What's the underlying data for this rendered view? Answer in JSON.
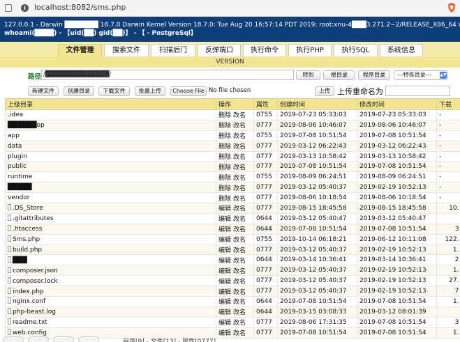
{
  "browser": {
    "url": "localhost:8082/sms.php"
  },
  "header": {
    "line1": "127.0.0.1 - Darwin ███████ 18.7.0 Darwin Kernel Version 18.7.0: Tue Aug 20 16:57:14 PDT 2019; root:xnu-4███3.271.2~2/RELEASE_X86_64 x86_64",
    "line2": "whoami(████) - 【uid(██) gid(██)】 - 【 - PostgreSql】"
  },
  "tabs": [
    "文件管理",
    "搜索文件",
    "扫描后门",
    "反弹端口",
    "执行命令",
    "执行PHP",
    "执行SQL",
    "系统信息"
  ],
  "version_label": "VERSION",
  "path": {
    "label": "路径",
    "value": "/██████████████/",
    "goto": "转到",
    "root_dir": "根目录",
    "app_dir": "程序目录",
    "special_select": "---特殊目录---"
  },
  "actions": {
    "new_file": "新建文件",
    "new_dir": "创建目录",
    "download": "下载文件",
    "batch_upload": "批量上传",
    "choose_file": "Choose File",
    "no_file": "No file chosen",
    "upload": "上传",
    "rename_label": "上传重命名为"
  },
  "table": {
    "headers": [
      "上级目录",
      "操作",
      "属性",
      "创建时间",
      "修改时间",
      "下载"
    ],
    "rows": [
      {
        "name": ".idea",
        "ops": [
          "删除",
          "改名"
        ],
        "perm": "0755",
        "created": "2019-07-23 05:33:03",
        "modified": "2019-07-23 05:33:03",
        "size": "-",
        "file": false
      },
      {
        "name": "██████op",
        "ops": [
          "删除",
          "改名"
        ],
        "perm": "0777",
        "created": "2019-08-06 10:46:07",
        "modified": "2019-08-06 10:46:07",
        "size": "-",
        "file": false
      },
      {
        "name": "app",
        "ops": [
          "删除",
          "改名"
        ],
        "perm": "0755",
        "created": "2019-07-08 10:51:54",
        "modified": "2019-07-08 10:51:54",
        "size": "-",
        "file": false
      },
      {
        "name": "data",
        "ops": [
          "删除",
          "改名"
        ],
        "perm": "0777",
        "created": "2019-03-12 06:22:43",
        "modified": "2019-03-12 06:22:43",
        "size": "-",
        "file": false
      },
      {
        "name": "plugin",
        "ops": [
          "删除",
          "改名"
        ],
        "perm": "0777",
        "created": "2019-03-13 10:58:42",
        "modified": "2019-03-13 10:58:42",
        "size": "-",
        "file": false
      },
      {
        "name": "public",
        "ops": [
          "删除",
          "改名"
        ],
        "perm": "0777",
        "created": "2019-07-08 10:51:54",
        "modified": "2019-07-08 10:51:54",
        "size": "-",
        "file": false
      },
      {
        "name": "runtime",
        "ops": [
          "删除",
          "改名"
        ],
        "perm": "0755",
        "created": "2019-08-09 06:24:51",
        "modified": "2019-08-09 06:24:51",
        "size": "-",
        "file": false
      },
      {
        "name": "█████",
        "ops": [
          "删除",
          "改名"
        ],
        "perm": "0777",
        "created": "2019-03-12 05:40:37",
        "modified": "2019-02-19 10:52:13",
        "size": "-",
        "file": false
      },
      {
        "name": "vendor",
        "ops": [
          "删除",
          "改名"
        ],
        "perm": "0777",
        "created": "2019-08-06 10:18:54",
        "modified": "2019-08-06 10:18:54",
        "size": "-",
        "file": false
      },
      {
        "name": ".DS_Store",
        "ops": [
          "编辑",
          "改名"
        ],
        "perm": "0777",
        "created": "2019-08-15 18:45:58",
        "modified": "2019-08-15 18:45:58",
        "size": "10.",
        "file": true
      },
      {
        "name": ".gitattributes",
        "ops": [
          "编辑",
          "改名"
        ],
        "perm": "0644",
        "created": "2019-03-12 05:40:47",
        "modified": "2019-03-12 05:40:47",
        "size": "",
        "file": true
      },
      {
        "name": ".htaccess",
        "ops": [
          "编辑",
          "改名"
        ],
        "perm": "0644",
        "created": "2019-07-08 10:51:54",
        "modified": "2019-07-08 10:51:54",
        "size": "3",
        "file": true
      },
      {
        "name": "Sms.php",
        "ops": [
          "编辑",
          "改名"
        ],
        "perm": "0755",
        "created": "2019-10-14 06:18:21",
        "modified": "2019-06-12 10:11:08",
        "size": "122.",
        "file": true
      },
      {
        "name": "build.php",
        "ops": [
          "编辑",
          "改名"
        ],
        "perm": "0777",
        "created": "2019-03-12 05:40:37",
        "modified": "2019-02-19 10:52:13",
        "size": "1.",
        "file": true
      },
      {
        "name": "███",
        "ops": [
          "编辑",
          "改名"
        ],
        "perm": "0644",
        "created": "2019-03-14 10:36:41",
        "modified": "2019-03-14 10:36:41",
        "size": "2",
        "file": true
      },
      {
        "name": "composer.json",
        "ops": [
          "编辑",
          "改名"
        ],
        "perm": "0777",
        "created": "2019-03-12 05:40:37",
        "modified": "2019-02-19 10:52:13",
        "size": "1.",
        "file": true
      },
      {
        "name": "composer.lock",
        "ops": [
          "编辑",
          "改名"
        ],
        "perm": "0777",
        "created": "2019-03-12 05:40:37",
        "modified": "2019-02-19 10:52:13",
        "size": "27.",
        "file": true
      },
      {
        "name": "index.php",
        "ops": [
          "编辑",
          "改名"
        ],
        "perm": "0777",
        "created": "2019-03-12 05:40:37",
        "modified": "2019-02-19 10:52:13",
        "size": "7",
        "file": true
      },
      {
        "name": "nginx.conf",
        "ops": [
          "编辑",
          "改名"
        ],
        "perm": "0644",
        "created": "2019-07-08 10:51:54",
        "modified": "2019-07-08 10:51:54",
        "size": "1.",
        "file": true
      },
      {
        "name": "php-beast.log",
        "ops": [
          "编辑",
          "改名"
        ],
        "perm": "0644",
        "created": "2019-03-15 03:08:33",
        "modified": "2019-03-12 08:01:39",
        "size": "",
        "file": true
      },
      {
        "name": "readme.txt",
        "ops": [
          "编辑",
          "改名"
        ],
        "perm": "0777",
        "created": "2019-08-06 17:31:35",
        "modified": "2019-07-08 10:51:54",
        "size": "3",
        "file": true
      },
      {
        "name": "web.config",
        "ops": [
          "编辑",
          "改名"
        ],
        "perm": "0777",
        "created": "2019-07-08 10:51:54",
        "modified": "2019-07-08 10:51:54",
        "size": "1.",
        "file": true
      }
    ]
  },
  "footer": {
    "summary": "目录[9] - 文件[13] - 属性[0777]"
  },
  "colors": {
    "header_bg": "#0e3f78",
    "tab_bar_bg": "#f6ecaa",
    "active_tab_bg": "#f1e591",
    "path_label": "#1a7d1a"
  }
}
